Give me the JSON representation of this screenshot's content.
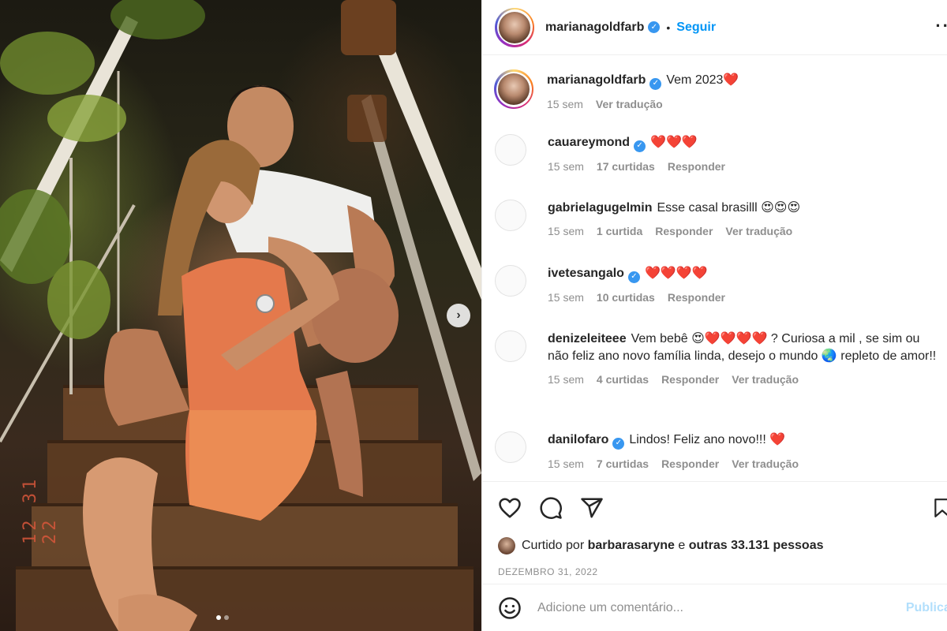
{
  "photo": {
    "date_stamp": "12 31 22",
    "next_icon": "chevron-right-icon",
    "carousel_total": 2,
    "carousel_active": 1
  },
  "header": {
    "username": "marianagoldfarb",
    "separator": "•",
    "follow_label": "Seguir",
    "more_icon": "more-horizontal-icon",
    "verified": true
  },
  "comments": [
    {
      "username": "marianagoldfarb",
      "verified": true,
      "text": "Vem 2023",
      "emoji": "❤️",
      "time": "15 sem",
      "likes": "",
      "reply": "",
      "translate": "Ver tradução"
    },
    {
      "username": "cauareymond",
      "verified": true,
      "text": "",
      "emoji": "❤️❤️❤️",
      "time": "15 sem",
      "likes": "17 curtidas",
      "reply": "Responder",
      "translate": ""
    },
    {
      "username": "gabrielagugelmin",
      "verified": false,
      "text": "Esse casal brasilll",
      "emoji": "😍😍😍",
      "time": "15 sem",
      "likes": "1 curtida",
      "reply": "Responder",
      "translate": "Ver tradução"
    },
    {
      "username": "ivetesangalo",
      "verified": true,
      "text": "",
      "emoji": "❤️❤️❤️❤️",
      "time": "15 sem",
      "likes": "10 curtidas",
      "reply": "Responder",
      "translate": ""
    },
    {
      "username": "denizeleiteee",
      "verified": false,
      "text": "Vem bebê 😍❤️❤️❤️❤️ ? Curiosa a mil , se sim ou não feliz ano novo família linda, desejo o mundo 🌏 repleto de amor!!",
      "emoji": "",
      "time": "15 sem",
      "likes": "4 curtidas",
      "reply": "Responder",
      "translate": "Ver tradução"
    },
    {
      "username": "danilofaro",
      "verified": true,
      "text": "Lindos! Feliz ano novo!!!",
      "emoji": "❤️",
      "time": "15 sem",
      "likes": "7 curtidas",
      "reply": "Responder",
      "translate": "Ver tradução"
    }
  ],
  "actions": {
    "like_icon": "heart-icon",
    "comment_icon": "comment-icon",
    "share_icon": "share-icon",
    "save_icon": "bookmark-icon",
    "liked_prefix": "Curtido por",
    "liked_user": "barbarasaryne",
    "liked_connector": "e",
    "liked_others": "outras 33.131 pessoas",
    "post_date": "DEZEMBRO 31, 2022"
  },
  "add_comment": {
    "emoji_icon": "smiley-icon",
    "placeholder": "Adicione um comentário...",
    "publish_label": "Publicar"
  },
  "colors": {
    "accent": "#0095f6",
    "verified": "#3897f0",
    "muted": "#8e8e8e",
    "publish_disabled": "#b2dffc"
  }
}
